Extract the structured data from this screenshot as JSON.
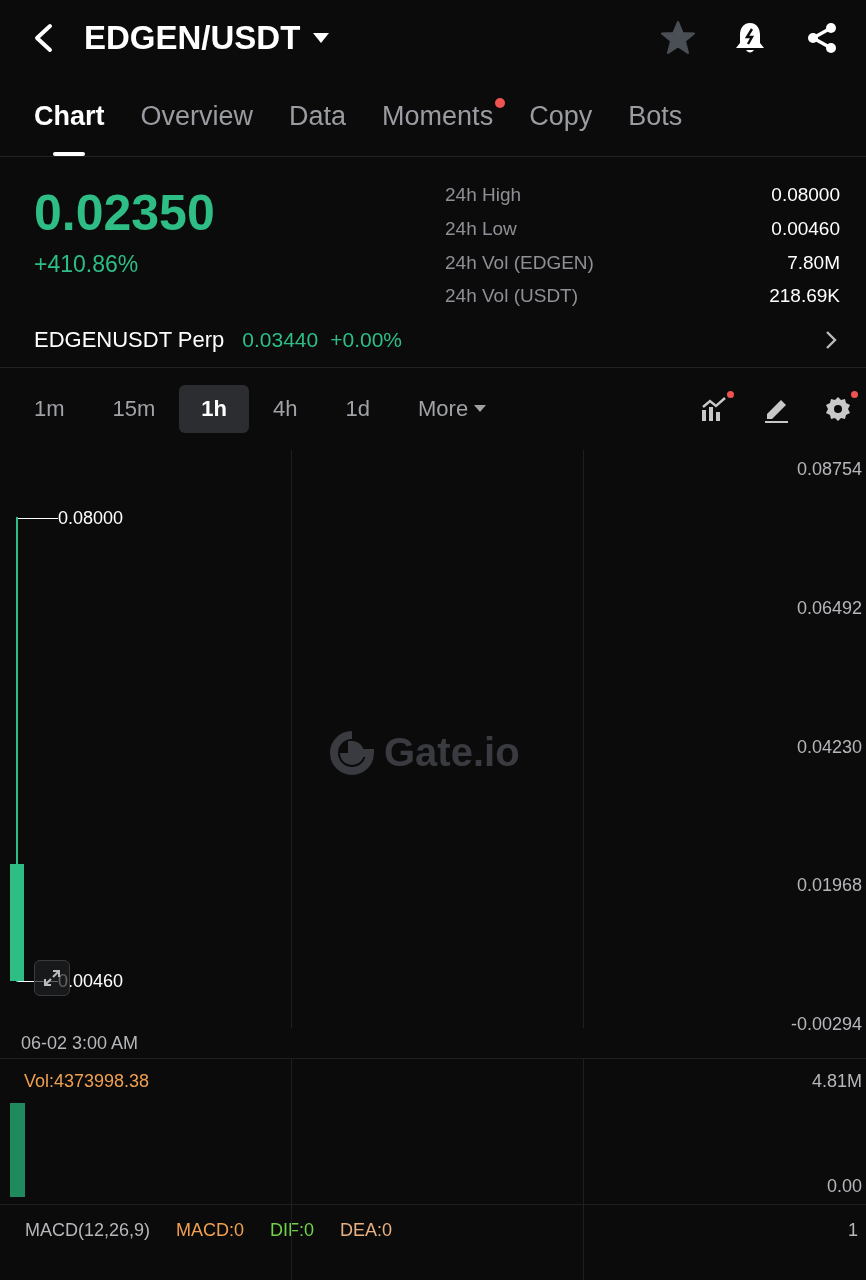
{
  "header": {
    "pair": "EDGEN/USDT",
    "favorite": false
  },
  "tabs": [
    {
      "label": "Chart",
      "selected": true,
      "dot": false
    },
    {
      "label": "Overview",
      "selected": false,
      "dot": false
    },
    {
      "label": "Data",
      "selected": false,
      "dot": false
    },
    {
      "label": "Moments",
      "selected": false,
      "dot": true
    },
    {
      "label": "Copy",
      "selected": false,
      "dot": false
    },
    {
      "label": "Bots",
      "selected": false,
      "dot": false
    }
  ],
  "price": {
    "last": "0.02350",
    "change": "+410.86%"
  },
  "stats": [
    {
      "label": "24h High",
      "value": "0.08000"
    },
    {
      "label": "24h Low",
      "value": "0.00460"
    },
    {
      "label": "24h Vol (EDGEN)",
      "value": "7.80M"
    },
    {
      "label": "24h Vol (USDT)",
      "value": "218.69K"
    }
  ],
  "perp": {
    "name": "EDGENUSDT Perp",
    "price": "0.03440",
    "change": "+0.00%"
  },
  "intervals": [
    {
      "label": "1m",
      "selected": false
    },
    {
      "label": "15m",
      "selected": false
    },
    {
      "label": "1h",
      "selected": true
    },
    {
      "label": "4h",
      "selected": false
    },
    {
      "label": "1d",
      "selected": false
    },
    {
      "label": "More",
      "selected": false
    }
  ],
  "tools": [
    {
      "kind": "indicators",
      "dot": true
    },
    {
      "kind": "draw",
      "dot": false
    },
    {
      "kind": "settings",
      "dot": true
    }
  ],
  "chart": {
    "watermark": "Gate.io",
    "price_axis": [
      "0.08754",
      "0.06492",
      "0.04230",
      "0.01968",
      "-0.00294"
    ],
    "high_label": "0.08000",
    "low_label": "0.00460",
    "time_label": "06-02 3:00 AM"
  },
  "volume": {
    "label": "Vol:4373998.38",
    "axis": [
      "4.81M",
      "0.00"
    ]
  },
  "macd": {
    "title": "MACD(12,26,9)",
    "values": [
      {
        "kind": "macd",
        "text": "MACD:0"
      },
      {
        "kind": "dif",
        "text": "DIF:0"
      },
      {
        "kind": "dea",
        "text": "DEA:0"
      }
    ],
    "axis": "1"
  }
}
